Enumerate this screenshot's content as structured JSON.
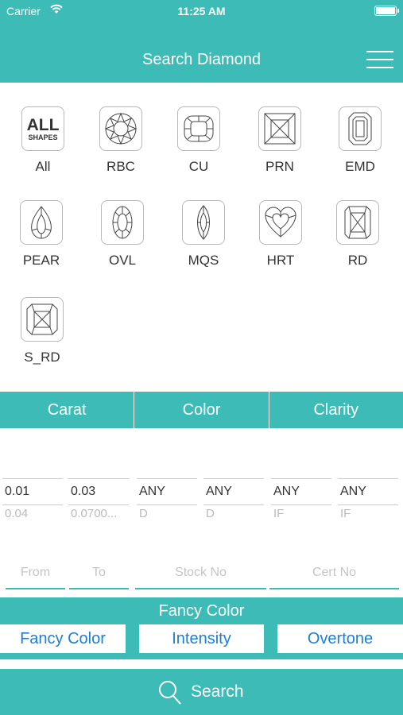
{
  "status": {
    "carrier": "Carrier",
    "time": "11:25 AM"
  },
  "header": {
    "title": "Search Diamond"
  },
  "shapes": [
    {
      "label": "All",
      "icon": "all-shapes-icon"
    },
    {
      "label": "RBC",
      "icon": "round-brilliant-icon"
    },
    {
      "label": "CU",
      "icon": "cushion-icon"
    },
    {
      "label": "PRN",
      "icon": "princess-icon"
    },
    {
      "label": "EMD",
      "icon": "emerald-icon"
    },
    {
      "label": "PEAR",
      "icon": "pear-icon"
    },
    {
      "label": "OVL",
      "icon": "oval-icon"
    },
    {
      "label": "MQS",
      "icon": "marquise-icon"
    },
    {
      "label": "HRT",
      "icon": "heart-icon"
    },
    {
      "label": "RD",
      "icon": "radiant-icon"
    },
    {
      "label": "S_RD",
      "icon": "square-radiant-icon"
    }
  ],
  "all_tile": {
    "big": "ALL",
    "small": "SHAPES"
  },
  "tabs": [
    "Carat",
    "Color",
    "Clarity"
  ],
  "pickers": [
    {
      "selected": "0.01",
      "next": "0.04"
    },
    {
      "selected": "0.03",
      "next": "0.0700..."
    },
    {
      "selected": "ANY",
      "next": "D"
    },
    {
      "selected": "ANY",
      "next": "D"
    },
    {
      "selected": "ANY",
      "next": "IF"
    },
    {
      "selected": "ANY",
      "next": "IF"
    }
  ],
  "inputs": {
    "from_placeholder": "From",
    "to_placeholder": "To",
    "stock_placeholder": "Stock No",
    "cert_placeholder": "Cert No"
  },
  "fancy": {
    "title": "Fancy Color",
    "buttons": [
      "Fancy Color",
      "Intensity",
      "Overtone"
    ]
  },
  "search": {
    "label": "Search"
  },
  "colors": {
    "accent": "#3dbbb6",
    "link": "#1a7fd6"
  }
}
